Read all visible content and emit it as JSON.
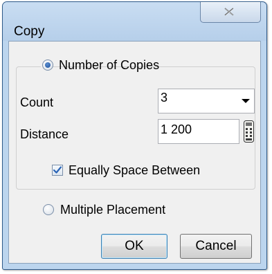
{
  "window": {
    "title": "Copy",
    "close_glyph": "✕"
  },
  "options": {
    "number_of_copies": {
      "label": "Number of Copies",
      "selected": true
    },
    "count": {
      "label": "Count",
      "value": "3"
    },
    "distance": {
      "label": "Distance",
      "value": "1 200",
      "icon": "calculator-icon"
    },
    "equally_space": {
      "label": "Equally Space Between",
      "checked": true
    },
    "multiple_placement": {
      "label": "Multiple Placement",
      "selected": false
    }
  },
  "buttons": {
    "ok": "OK",
    "cancel": "Cancel"
  },
  "colors": {
    "title_bar": "#bcd5ee",
    "dialog_body": "#f0f0f0",
    "radio_dot": "#1c4f9a",
    "check_mark": "#2a64b6"
  }
}
